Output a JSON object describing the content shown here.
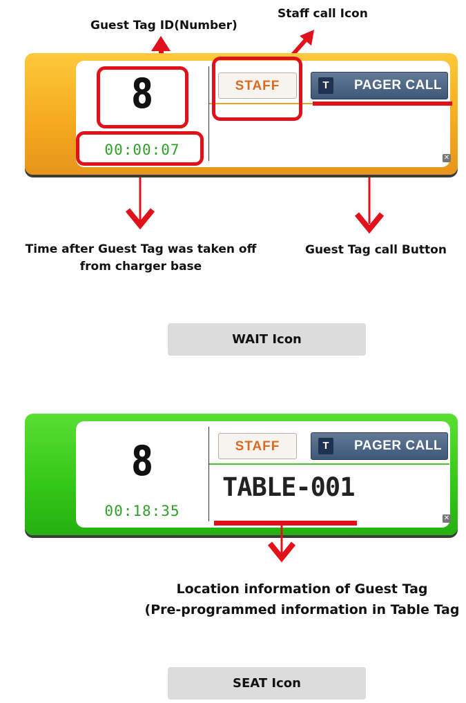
{
  "annotations": {
    "guest_tag_id": "Guest Tag ID(Number)",
    "staff_call_icon": "Staff call Icon",
    "time_after_line1": "Time after Guest Tag was taken off",
    "time_after_line2": "from charger base",
    "guest_tag_call_button": "Guest Tag call Button",
    "location_line1": "Location information of Guest Tag",
    "location_line2": "(Pre-programmed information in Table Tag"
  },
  "wait_widget": {
    "tag_number": "8",
    "timer": "00:00:07",
    "timer_color": "#2f9f2a",
    "staff_label": "STAFF",
    "pager_t_label": "T",
    "pager_label": "PAGER CALL",
    "close_icon": "close-icon",
    "accent": "#f4a820"
  },
  "wait_label": "WAIT Icon",
  "seat_widget": {
    "tag_number": "8",
    "timer": "00:18:35",
    "timer_color": "#2f9f2a",
    "staff_label": "STAFF",
    "pager_t_label": "T",
    "pager_label": "PAGER CALL",
    "location": "TABLE-001",
    "close_icon": "close-icon",
    "accent": "#33c718"
  },
  "seat_label": "SEAT Icon",
  "colors": {
    "annotation_red": "#e1111b",
    "wait_orange": "#f4a820",
    "seat_green": "#33c718",
    "staff_text": "#d96a1e",
    "pager_blue": "#3e5878"
  }
}
